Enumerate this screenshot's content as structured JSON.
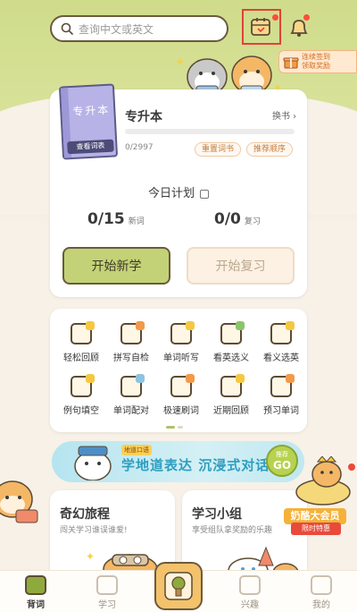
{
  "search": {
    "placeholder": "查询中文或英文"
  },
  "signin": {
    "line1": "连续签到",
    "line2": "领取奖励"
  },
  "book": {
    "cover_title": "专升本",
    "view_label": "查看词表",
    "name": "专升本",
    "switch_label": "换书",
    "progress": "0/2997",
    "progress_fraction": 0.0
  },
  "actions": {
    "reset": "重置词书",
    "order": "推荐顺序"
  },
  "plan": {
    "title": "今日计划",
    "new_count": "0/15",
    "new_label": "新词",
    "review_count": "0/0",
    "review_label": "复习"
  },
  "buttons": {
    "start_learn": "开始新学",
    "start_review": "开始复习"
  },
  "tools": [
    {
      "label": "轻松回顾",
      "color": "#f5c842"
    },
    {
      "label": "拼写自检",
      "color": "#f19a4b"
    },
    {
      "label": "单词听写",
      "color": "#f5c842"
    },
    {
      "label": "看英选义",
      "color": "#8cc46a"
    },
    {
      "label": "看义选英",
      "color": "#f5c842"
    },
    {
      "label": "例句填空",
      "color": "#f5c842"
    },
    {
      "label": "单词配对",
      "color": "#8cc4e0"
    },
    {
      "label": "极速刷词",
      "color": "#f19a4b"
    },
    {
      "label": "近期回顾",
      "color": "#f5c842"
    },
    {
      "label": "预习单词",
      "color": "#f19a4b"
    }
  ],
  "promo": {
    "badge": "地道口语",
    "text": "学地道表达 沉浸式对话",
    "btn_top": "推荐",
    "btn_main": "GO"
  },
  "journey": {
    "title": "奇幻旅程",
    "subtitle": "闯关学习谁误谁爱!"
  },
  "group": {
    "title": "学习小组",
    "subtitle": "享受组队拿奖励的乐趣"
  },
  "vip": {
    "label": "奶酪大会员",
    "sub": "限时特惠"
  },
  "nav": [
    {
      "label": "背词",
      "active": true
    },
    {
      "label": "学习",
      "active": false
    },
    {
      "label": "",
      "active": false
    },
    {
      "label": "兴趣",
      "active": false
    },
    {
      "label": "我的",
      "active": false
    }
  ]
}
